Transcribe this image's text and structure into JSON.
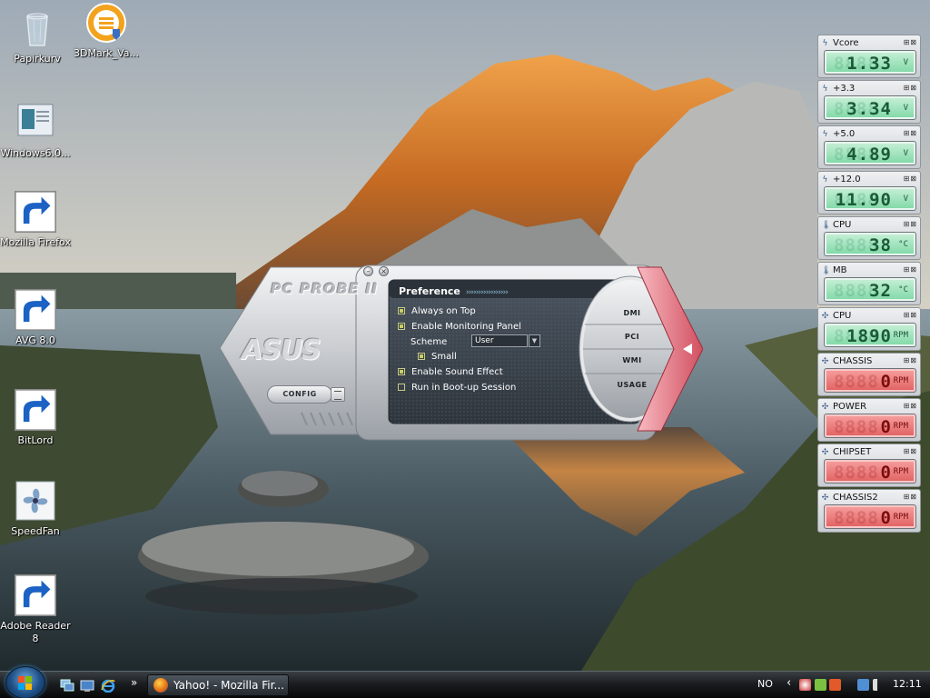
{
  "desktop_icons": [
    {
      "id": "papirkurv",
      "label": "Papirkurv",
      "icon": "recycle-bin-icon"
    },
    {
      "id": "3dmark",
      "label": "3DMark_Va...",
      "icon": "3dmark-icon"
    },
    {
      "id": "windows6",
      "label": "Windows6.0...",
      "icon": "document-icon"
    },
    {
      "id": "firefox",
      "label": "Mozilla Firefox",
      "icon": "firefox-icon"
    },
    {
      "id": "avg",
      "label": "AVG 8.0",
      "icon": "avg-icon"
    },
    {
      "id": "bitlord",
      "label": "BitLord",
      "icon": "bitlord-icon"
    },
    {
      "id": "speedfan",
      "label": "SpeedFan",
      "icon": "fan-icon"
    },
    {
      "id": "adobe",
      "label": "Adobe Reader 8",
      "icon": "adobe-reader-icon"
    }
  ],
  "probe": {
    "title": "PC PROBE II",
    "logo": "ASUS",
    "config_label": "CONFIG",
    "preference": {
      "header": "Preference",
      "options": [
        {
          "label": "Always on Top",
          "checked": true
        },
        {
          "label": "Enable Monitoring Panel",
          "checked": true
        },
        {
          "label": "Scheme",
          "value": "User"
        },
        {
          "label": "Small",
          "checked": true
        },
        {
          "label": "Enable Sound Effect",
          "checked": true
        },
        {
          "label": "Run in Boot-up Session",
          "checked": false
        }
      ]
    },
    "nav": [
      "DMI",
      "PCI",
      "WMI",
      "USAGE"
    ]
  },
  "sensors": [
    {
      "label": "Vcore",
      "value": "1.33",
      "unit": "V",
      "ghost": "8888",
      "color": "green",
      "icon": "voltage-icon"
    },
    {
      "label": "+3.3",
      "value": "3.34",
      "unit": "V",
      "ghost": "8888",
      "color": "green",
      "icon": "voltage-icon"
    },
    {
      "label": "+5.0",
      "value": "4.89",
      "unit": "V",
      "ghost": "8888",
      "color": "green",
      "icon": "voltage-icon"
    },
    {
      "label": "+12.0",
      "value": "11.90",
      "unit": "V",
      "ghost": "8888",
      "color": "green",
      "icon": "voltage-icon"
    },
    {
      "label": "CPU",
      "value": "38",
      "unit": "°C",
      "ghost": "8888",
      "color": "green",
      "icon": "thermometer-icon"
    },
    {
      "label": "MB",
      "value": "32",
      "unit": "°C",
      "ghost": "8888",
      "color": "green",
      "icon": "thermometer-icon"
    },
    {
      "label": "CPU",
      "value": "1890",
      "unit": "RPM",
      "ghost": "8888",
      "color": "green",
      "icon": "fan-icon"
    },
    {
      "label": "CHASSIS",
      "value": "0",
      "unit": "RPM",
      "ghost": "8888",
      "color": "red",
      "icon": "fan-icon"
    },
    {
      "label": "POWER",
      "value": "0",
      "unit": "RPM",
      "ghost": "8888",
      "color": "red",
      "icon": "fan-icon"
    },
    {
      "label": "CHIPSET",
      "value": "0",
      "unit": "RPM",
      "ghost": "8888",
      "color": "red",
      "icon": "fan-icon"
    },
    {
      "label": "CHASSIS2",
      "value": "0",
      "unit": "RPM",
      "ghost": "8888",
      "color": "red",
      "icon": "fan-icon"
    }
  ],
  "taskbar": {
    "start_icon": "windows-start-icon",
    "quicklaunch": [
      "switch-windows-icon",
      "show-desktop-icon",
      "internet-explorer-icon"
    ],
    "quicklaunch_more": "»",
    "task_label": "Yahoo! - Mozilla Fir...",
    "language": "NO",
    "tray_expand": "‹",
    "clock": "12:11"
  },
  "colors": {
    "accent": "#1e4f86",
    "lcd_green": "#7fd8a6",
    "lcd_red": "#e06060",
    "probe_panel": "#3a434c"
  }
}
